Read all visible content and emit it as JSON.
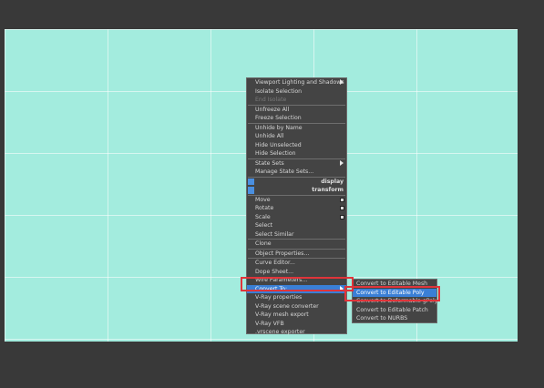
{
  "quad_menu": {
    "items": [
      {
        "label": "Viewport Lighting and Shadows",
        "arrow": true
      },
      {
        "label": "Isolate Selection"
      },
      {
        "label": "End Isolate",
        "disabled": true
      },
      {
        "label": "Unfreeze All"
      },
      {
        "label": "Freeze Selection"
      },
      {
        "label": "Unhide by Name"
      },
      {
        "label": "Unhide All"
      },
      {
        "label": "Hide Unselected"
      },
      {
        "label": "Hide Selection"
      },
      {
        "label": "State Sets",
        "arrow": true
      },
      {
        "label": "Manage State Sets..."
      }
    ],
    "display_header": "display",
    "transform_header": "transform",
    "transform_items": [
      {
        "label": "Move"
      },
      {
        "label": "Rotate"
      },
      {
        "label": "Scale"
      },
      {
        "label": "Select"
      },
      {
        "label": "Select Similar"
      },
      {
        "label": "Clone"
      },
      {
        "label": "Object Properties..."
      },
      {
        "label": "Curve Editor..."
      },
      {
        "label": "Dope Sheet..."
      },
      {
        "label": "Wire Parameters..."
      },
      {
        "label": "Convert To:"
      },
      {
        "label": "V-Ray properties"
      },
      {
        "label": "V-Ray scene converter"
      },
      {
        "label": "V-Ray mesh export"
      },
      {
        "label": "V-Ray VFB"
      },
      {
        "label": ".vrscene exporter"
      }
    ]
  },
  "convert_submenu": {
    "items": [
      {
        "label": "Convert to Editable Mesh"
      },
      {
        "label": "Convert to Editable Poly"
      },
      {
        "label": "Convert to Deformable gPoly"
      },
      {
        "label": "Convert to Editable Patch"
      },
      {
        "label": "Convert to NURBS"
      }
    ]
  },
  "colors": {
    "viewport": "#a3ecde",
    "menu_bg": "#444444",
    "highlight": "#3a7fd6",
    "callout": "#e0343a"
  }
}
